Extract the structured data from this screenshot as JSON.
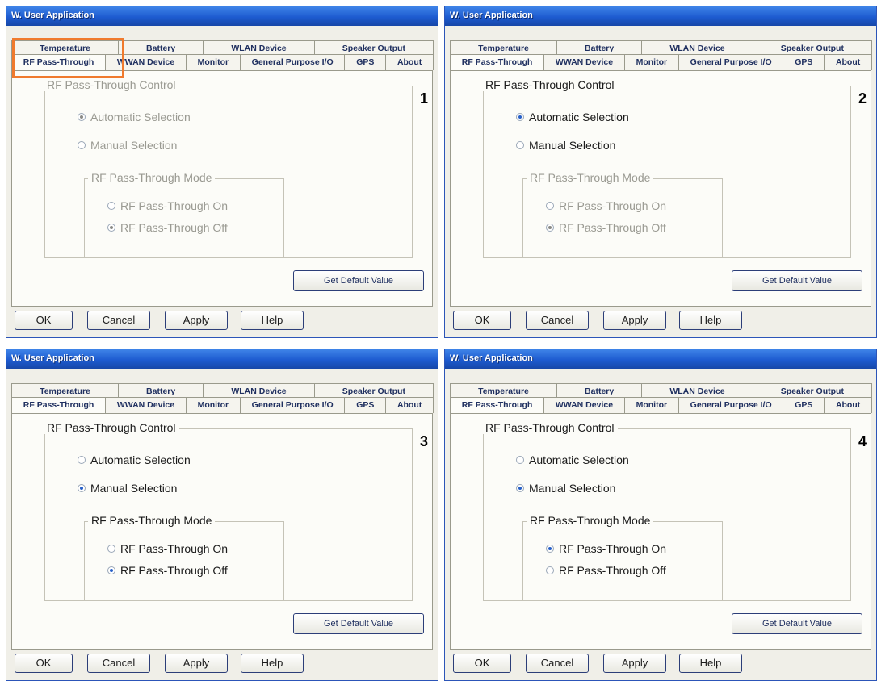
{
  "window_title": "W. User Application",
  "tabs_back": [
    "Temperature",
    "Battery",
    "WLAN Device",
    "Speaker Output"
  ],
  "tabs_front": [
    "RF Pass-Through",
    "WWAN Device",
    "Monitor",
    "General Purpose I/O",
    "GPS",
    "About"
  ],
  "group_title": "RF Pass-Through Control",
  "radio_auto": "Automatic Selection",
  "radio_manual": "Manual Selection",
  "mode_title": "RF Pass-Through Mode",
  "radio_on": "RF Pass-Through On",
  "radio_off": "RF Pass-Through Off",
  "default_button": "Get Default Value",
  "buttons": {
    "ok": "OK",
    "cancel": "Cancel",
    "apply": "Apply",
    "help": "Help"
  },
  "panels": [
    {
      "number": "1",
      "control_disabled": true,
      "mode_disabled": true,
      "auto": true,
      "on": false
    },
    {
      "number": "2",
      "control_disabled": false,
      "mode_disabled": true,
      "auto": true,
      "on": false
    },
    {
      "number": "3",
      "control_disabled": false,
      "mode_disabled": false,
      "auto": false,
      "on": false
    },
    {
      "number": "4",
      "control_disabled": false,
      "mode_disabled": false,
      "auto": false,
      "on": true
    }
  ],
  "highlight_color": "#f07a2d"
}
